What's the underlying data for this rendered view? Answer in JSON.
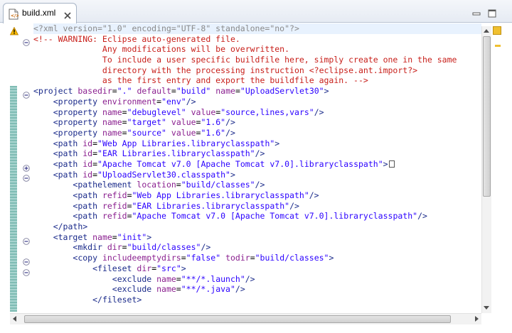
{
  "tab": {
    "title": "build.xml",
    "icon": "xml-file-icon"
  },
  "window_controls": {
    "minimize_icon": "minimize-icon",
    "maximize_icon": "maximize-icon"
  },
  "colors": {
    "comment": "#c8201b",
    "tag": "#1a2a8a",
    "attr_name": "#8a1f8f",
    "attr_value": "#2a00ff",
    "processing_instruction": "#8a8a8a",
    "change_bar": "#7fbcb4",
    "warning": "#f0a000"
  },
  "editor": {
    "lines": [
      {
        "indent": "",
        "tokens": [
          [
            "pi",
            "<?xml version=\"1.0\" encoding=\"UTF-8\" standalone=\"no\"?>"
          ]
        ]
      },
      {
        "indent": "",
        "tokens": [
          [
            "cm",
            "<!-- WARNING: Eclipse auto-generated file."
          ]
        ]
      },
      {
        "indent": "",
        "tokens": [
          [
            "cm",
            "              Any modifications will be overwritten."
          ]
        ]
      },
      {
        "indent": "",
        "tokens": [
          [
            "cm",
            "              To include a user specific buildfile here, simply create one in the same"
          ]
        ]
      },
      {
        "indent": "",
        "tokens": [
          [
            "cm",
            "              directory with the processing instruction <?eclipse.ant.import?>"
          ]
        ]
      },
      {
        "indent": "",
        "tokens": [
          [
            "cm",
            "              as the first entry and export the buildfile again. -->"
          ]
        ]
      },
      {
        "indent": "",
        "tokens": [
          [
            "tag",
            "<project "
          ],
          [
            "an",
            "basedir"
          ],
          [
            "tx",
            "="
          ],
          [
            "av",
            "\".\""
          ],
          [
            "tx",
            " "
          ],
          [
            "an",
            "default"
          ],
          [
            "tx",
            "="
          ],
          [
            "av",
            "\"build\""
          ],
          [
            "tx",
            " "
          ],
          [
            "an",
            "name"
          ],
          [
            "tx",
            "="
          ],
          [
            "av",
            "\"UploadServlet30\""
          ],
          [
            "tag",
            ">"
          ]
        ]
      },
      {
        "indent": "    ",
        "tokens": [
          [
            "tag",
            "<property "
          ],
          [
            "an",
            "environment"
          ],
          [
            "tx",
            "="
          ],
          [
            "av",
            "\"env\""
          ],
          [
            "tag",
            "/>"
          ]
        ]
      },
      {
        "indent": "    ",
        "tokens": [
          [
            "tag",
            "<property "
          ],
          [
            "an",
            "name"
          ],
          [
            "tx",
            "="
          ],
          [
            "av",
            "\"debuglevel\""
          ],
          [
            "tx",
            " "
          ],
          [
            "an",
            "value"
          ],
          [
            "tx",
            "="
          ],
          [
            "av",
            "\"source,lines,vars\""
          ],
          [
            "tag",
            "/>"
          ]
        ]
      },
      {
        "indent": "    ",
        "tokens": [
          [
            "tag",
            "<property "
          ],
          [
            "an",
            "name"
          ],
          [
            "tx",
            "="
          ],
          [
            "av",
            "\"target\""
          ],
          [
            "tx",
            " "
          ],
          [
            "an",
            "value"
          ],
          [
            "tx",
            "="
          ],
          [
            "av",
            "\"1.6\""
          ],
          [
            "tag",
            "/>"
          ]
        ]
      },
      {
        "indent": "    ",
        "tokens": [
          [
            "tag",
            "<property "
          ],
          [
            "an",
            "name"
          ],
          [
            "tx",
            "="
          ],
          [
            "av",
            "\"source\""
          ],
          [
            "tx",
            " "
          ],
          [
            "an",
            "value"
          ],
          [
            "tx",
            "="
          ],
          [
            "av",
            "\"1.6\""
          ],
          [
            "tag",
            "/>"
          ]
        ]
      },
      {
        "indent": "    ",
        "tokens": [
          [
            "tag",
            "<path "
          ],
          [
            "an",
            "id"
          ],
          [
            "tx",
            "="
          ],
          [
            "av",
            "\"Web App Libraries.libraryclasspath\""
          ],
          [
            "tag",
            ">"
          ]
        ]
      },
      {
        "indent": "    ",
        "tokens": [
          [
            "tag",
            "<path "
          ],
          [
            "an",
            "id"
          ],
          [
            "tx",
            "="
          ],
          [
            "av",
            "\"EAR Libraries.libraryclasspath\""
          ],
          [
            "tag",
            "/>"
          ]
        ]
      },
      {
        "indent": "    ",
        "tokens": [
          [
            "tag",
            "<path "
          ],
          [
            "an",
            "id"
          ],
          [
            "tx",
            "="
          ],
          [
            "av",
            "\"Apache Tomcat v7.0 [Apache Tomcat v7.0].libraryclasspath\""
          ],
          [
            "tag",
            ">"
          ]
        ]
      },
      {
        "indent": "    ",
        "tokens": [
          [
            "tag",
            "<path "
          ],
          [
            "an",
            "id"
          ],
          [
            "tx",
            "="
          ],
          [
            "av",
            "\"UploadServlet30.classpath\""
          ],
          [
            "tag",
            ">"
          ]
        ]
      },
      {
        "indent": "        ",
        "tokens": [
          [
            "tag",
            "<pathelement "
          ],
          [
            "an",
            "location"
          ],
          [
            "tx",
            "="
          ],
          [
            "av",
            "\"build/classes\""
          ],
          [
            "tag",
            "/>"
          ]
        ]
      },
      {
        "indent": "        ",
        "tokens": [
          [
            "tag",
            "<path "
          ],
          [
            "an",
            "refid"
          ],
          [
            "tx",
            "="
          ],
          [
            "av",
            "\"Web App Libraries.libraryclasspath\""
          ],
          [
            "tag",
            "/>"
          ]
        ]
      },
      {
        "indent": "        ",
        "tokens": [
          [
            "tag",
            "<path "
          ],
          [
            "an",
            "refid"
          ],
          [
            "tx",
            "="
          ],
          [
            "av",
            "\"EAR Libraries.libraryclasspath\""
          ],
          [
            "tag",
            "/>"
          ]
        ]
      },
      {
        "indent": "        ",
        "tokens": [
          [
            "tag",
            "<path "
          ],
          [
            "an",
            "refid"
          ],
          [
            "tx",
            "="
          ],
          [
            "av",
            "\"Apache Tomcat v7.0 [Apache Tomcat v7.0].libraryclasspath\""
          ],
          [
            "tag",
            "/>"
          ]
        ]
      },
      {
        "indent": "    ",
        "tokens": [
          [
            "tag",
            "</path>"
          ]
        ]
      },
      {
        "indent": "    ",
        "tokens": [
          [
            "tag",
            "<target "
          ],
          [
            "an",
            "name"
          ],
          [
            "tx",
            "="
          ],
          [
            "av",
            "\"init\""
          ],
          [
            "tag",
            ">"
          ]
        ]
      },
      {
        "indent": "        ",
        "tokens": [
          [
            "tag",
            "<mkdir "
          ],
          [
            "an",
            "dir"
          ],
          [
            "tx",
            "="
          ],
          [
            "av",
            "\"build/classes\""
          ],
          [
            "tag",
            "/>"
          ]
        ]
      },
      {
        "indent": "        ",
        "tokens": [
          [
            "tag",
            "<copy "
          ],
          [
            "an",
            "includeemptydirs"
          ],
          [
            "tx",
            "="
          ],
          [
            "av",
            "\"false\""
          ],
          [
            "tx",
            " "
          ],
          [
            "an",
            "todir"
          ],
          [
            "tx",
            "="
          ],
          [
            "av",
            "\"build/classes\""
          ],
          [
            "tag",
            ">"
          ]
        ]
      },
      {
        "indent": "            ",
        "tokens": [
          [
            "tag",
            "<fileset "
          ],
          [
            "an",
            "dir"
          ],
          [
            "tx",
            "="
          ],
          [
            "av",
            "\"src\""
          ],
          [
            "tag",
            ">"
          ]
        ]
      },
      {
        "indent": "                ",
        "tokens": [
          [
            "tag",
            "<exclude "
          ],
          [
            "an",
            "name"
          ],
          [
            "tx",
            "="
          ],
          [
            "av",
            "\"**/*.launch\""
          ],
          [
            "tag",
            "/>"
          ]
        ]
      },
      {
        "indent": "                ",
        "tokens": [
          [
            "tag",
            "<exclude "
          ],
          [
            "an",
            "name"
          ],
          [
            "tx",
            "="
          ],
          [
            "av",
            "\"**/*.java\""
          ],
          [
            "tag",
            "/>"
          ]
        ]
      },
      {
        "indent": "            ",
        "tokens": [
          [
            "tag",
            "</fileset>"
          ]
        ]
      }
    ],
    "fold_markers": [
      {
        "line": 1,
        "state": "expanded"
      },
      {
        "line": 6,
        "state": "expanded"
      },
      {
        "line": 13,
        "state": "collapsed"
      },
      {
        "line": 14,
        "state": "expanded"
      },
      {
        "line": 20,
        "state": "expanded"
      },
      {
        "line": 22,
        "state": "expanded"
      },
      {
        "line": 23,
        "state": "expanded"
      }
    ],
    "warning_line": 0
  }
}
